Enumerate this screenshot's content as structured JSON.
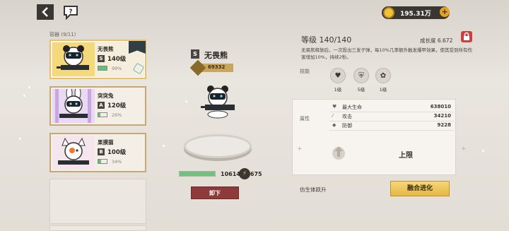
{
  "header": {
    "back_icon": "back-arrow-icon",
    "help_icon": "help-bubble-icon",
    "currency_value": "195.31万",
    "currency_icon": "gold-coin-icon",
    "add_icon": "plus-icon"
  },
  "roster": {
    "count_label": "容器 (9/11)",
    "cards": [
      {
        "name": "无畏熊",
        "rank": "S",
        "level": "140级",
        "energy_pct": "99%",
        "energy_fraction": 0.99,
        "selected": true
      },
      {
        "name": "突突兔",
        "rank": "A",
        "level": "120级",
        "energy_pct": "26%",
        "energy_fraction": 0.26,
        "selected": false
      },
      {
        "name": "果摸猫",
        "rank": "B",
        "level": "100级",
        "energy_pct": "34%",
        "energy_fraction": 0.34,
        "selected": false
      }
    ]
  },
  "character": {
    "rank": "S",
    "name": "无畏熊",
    "power": "69332",
    "energy_value": "10614/10675",
    "energy_fraction": 0.99,
    "unequip_label": "卸下"
  },
  "detail": {
    "level": "等级 140/140",
    "growth": "成长度 6.672",
    "description": "无畏熊释放后，一次投出三发子弹，每10%几率额外触发爆甲效果，使其受到所有伤害增加10%，持续2秒。",
    "skills_label": "技能",
    "skills": [
      {
        "icon": "heart-icon",
        "level": "1级"
      },
      {
        "icon": "shield-icon",
        "level": "5级"
      },
      {
        "icon": "paw-icon",
        "level": "1级"
      }
    ],
    "attr_label": "属性",
    "stats": [
      {
        "icon": "heart-icon",
        "label": "最大生命",
        "value": "638010"
      },
      {
        "icon": "sword-icon",
        "label": "攻击",
        "value": "34210"
      },
      {
        "icon": "shield-icon",
        "label": "防御",
        "value": "9228"
      }
    ],
    "cap_label": "上限",
    "evo_hint": "仿生体跃升",
    "evo_button": "融合进化"
  }
}
